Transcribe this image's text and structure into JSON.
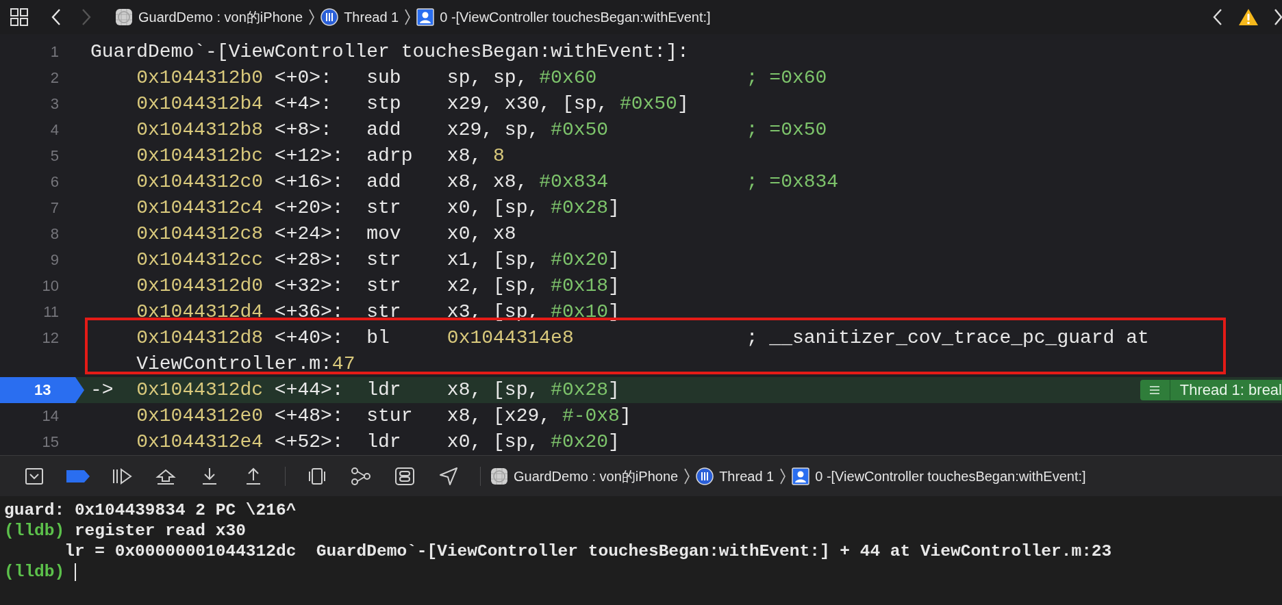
{
  "nav_bar": {
    "back_enabled": true,
    "forward_enabled": false,
    "breadcrumb": [
      {
        "kind": "app",
        "label": "GuardDemo : von的iPhone"
      },
      {
        "kind": "thread",
        "label": "Thread 1"
      },
      {
        "kind": "frame",
        "label": "0 -[ViewController touchesBegan:withEvent:]"
      }
    ]
  },
  "disassembly": {
    "header": {
      "number": "1",
      "text": "GuardDemo`-[ViewController touchesBegan:withEvent:]:"
    },
    "lines": [
      {
        "number": "2",
        "current": false,
        "annotated": false,
        "address": "0x1044312b0",
        "offset": "<+0>:",
        "mnemonic": "sub",
        "operands": [
          {
            "text": "sp, sp, ",
            "kind": "plain"
          },
          {
            "text": "#0x60",
            "kind": "imm"
          }
        ],
        "comment": [
          {
            "text": "; =0x60",
            "kind": "imm"
          }
        ]
      },
      {
        "number": "3",
        "current": false,
        "annotated": false,
        "address": "0x1044312b4",
        "offset": "<+4>:",
        "mnemonic": "stp",
        "operands": [
          {
            "text": "x29, x30, [sp, ",
            "kind": "plain"
          },
          {
            "text": "#0x50",
            "kind": "imm"
          },
          {
            "text": "]",
            "kind": "plain"
          }
        ]
      },
      {
        "number": "4",
        "current": false,
        "annotated": false,
        "address": "0x1044312b8",
        "offset": "<+8>:",
        "mnemonic": "add",
        "operands": [
          {
            "text": "x29, sp, ",
            "kind": "plain"
          },
          {
            "text": "#0x50",
            "kind": "imm"
          }
        ],
        "comment": [
          {
            "text": "; =0x50",
            "kind": "imm"
          }
        ]
      },
      {
        "number": "5",
        "current": false,
        "annotated": false,
        "address": "0x1044312bc",
        "offset": "<+12>:",
        "mnemonic": "adrp",
        "operands": [
          {
            "text": "x8, ",
            "kind": "plain"
          },
          {
            "text": "8",
            "kind": "number"
          }
        ]
      },
      {
        "number": "6",
        "current": false,
        "annotated": false,
        "address": "0x1044312c0",
        "offset": "<+16>:",
        "mnemonic": "add",
        "operands": [
          {
            "text": "x8, x8, ",
            "kind": "plain"
          },
          {
            "text": "#0x834",
            "kind": "imm"
          }
        ],
        "comment": [
          {
            "text": "; =0x834",
            "kind": "imm"
          }
        ]
      },
      {
        "number": "7",
        "current": false,
        "annotated": false,
        "address": "0x1044312c4",
        "offset": "<+20>:",
        "mnemonic": "str",
        "operands": [
          {
            "text": "x0, [sp, ",
            "kind": "plain"
          },
          {
            "text": "#0x28",
            "kind": "imm"
          },
          {
            "text": "]",
            "kind": "plain"
          }
        ]
      },
      {
        "number": "8",
        "current": false,
        "annotated": false,
        "address": "0x1044312c8",
        "offset": "<+24>:",
        "mnemonic": "mov",
        "operands": [
          {
            "text": "x0, x8",
            "kind": "plain"
          }
        ]
      },
      {
        "number": "9",
        "current": false,
        "annotated": false,
        "address": "0x1044312cc",
        "offset": "<+28>:",
        "mnemonic": "str",
        "operands": [
          {
            "text": "x1, [sp, ",
            "kind": "plain"
          },
          {
            "text": "#0x20",
            "kind": "imm"
          },
          {
            "text": "]",
            "kind": "plain"
          }
        ]
      },
      {
        "number": "10",
        "current": false,
        "annotated": false,
        "address": "0x1044312d0",
        "offset": "<+32>:",
        "mnemonic": "str",
        "operands": [
          {
            "text": "x2, [sp, ",
            "kind": "plain"
          },
          {
            "text": "#0x18",
            "kind": "imm"
          },
          {
            "text": "]",
            "kind": "plain"
          }
        ]
      },
      {
        "number": "11",
        "current": false,
        "annotated": false,
        "address": "0x1044312d4",
        "offset": "<+36>:",
        "mnemonic": "str",
        "operands": [
          {
            "text": "x3, [sp, ",
            "kind": "plain"
          },
          {
            "text": "#0x10",
            "kind": "imm"
          },
          {
            "text": "]",
            "kind": "plain"
          }
        ]
      },
      {
        "number": "12",
        "current": false,
        "annotated": true,
        "address": "0x1044312d8",
        "offset": "<+40>:",
        "mnemonic": "bl",
        "operands": [
          {
            "text": "0x1044314e8",
            "kind": "number"
          }
        ],
        "comment": [
          {
            "text": "; __sanitizer_cov_trace_pc_guard at",
            "kind": "plain"
          }
        ],
        "continuation": [
          {
            "text": "ViewController.m:",
            "kind": "plain"
          },
          {
            "text": "47",
            "kind": "number"
          }
        ]
      },
      {
        "number": "13",
        "current": true,
        "annotated": false,
        "marker": "->",
        "address": "0x1044312dc",
        "offset": "<+44>:",
        "mnemonic": "ldr",
        "operands": [
          {
            "text": "x8, [sp, ",
            "kind": "plain"
          },
          {
            "text": "#0x28",
            "kind": "imm"
          },
          {
            "text": "]",
            "kind": "plain"
          }
        ],
        "badge": "Thread 1: breal"
      },
      {
        "number": "14",
        "current": false,
        "annotated": false,
        "address": "0x1044312e0",
        "offset": "<+48>:",
        "mnemonic": "stur",
        "operands": [
          {
            "text": "x8, [x29, ",
            "kind": "plain"
          },
          {
            "text": "#-0x8",
            "kind": "imm"
          },
          {
            "text": "]",
            "kind": "plain"
          }
        ]
      },
      {
        "number": "15",
        "current": false,
        "annotated": false,
        "address": "0x1044312e4",
        "offset": "<+52>:",
        "mnemonic": "ldr",
        "operands": [
          {
            "text": "x0, [sp, ",
            "kind": "plain"
          },
          {
            "text": "#0x20",
            "kind": "imm"
          },
          {
            "text": "]",
            "kind": "plain"
          }
        ]
      }
    ]
  },
  "debug_bar": {
    "breakpoints_active": true,
    "breadcrumb": [
      {
        "kind": "app",
        "label": "GuardDemo : von的iPhone"
      },
      {
        "kind": "thread",
        "label": "Thread 1"
      },
      {
        "kind": "frame",
        "label": "0 -[ViewController touchesBegan:withEvent:]"
      }
    ]
  },
  "console": {
    "lines": [
      {
        "kind": "output",
        "text": "guard: 0x104439834 2 PC \\216^"
      },
      {
        "kind": "command",
        "prompt": "(lldb)",
        "text": "register read x30"
      },
      {
        "kind": "result",
        "text": "lr = 0x00000001044312dc  GuardDemo`-[ViewController touchesBegan:withEvent:] + 44 at ViewController.m:23"
      },
      {
        "kind": "input",
        "prompt": "(lldb)",
        "cursor": true
      }
    ]
  }
}
